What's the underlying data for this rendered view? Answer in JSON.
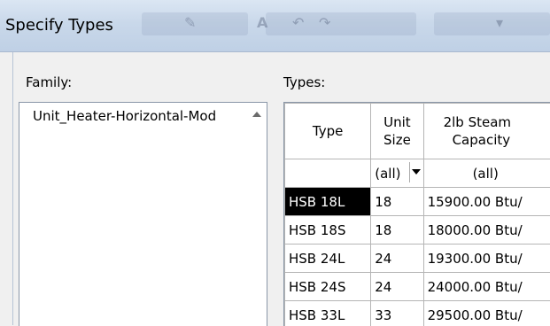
{
  "window": {
    "title": "Specify Types"
  },
  "family": {
    "label": "Family:",
    "items": [
      "Unit_Heater-Horizontal-Mod"
    ]
  },
  "types": {
    "label": "Types:",
    "columns": [
      {
        "line1": "Type",
        "line2": ""
      },
      {
        "line1": "Unit",
        "line2": "Size"
      },
      {
        "line1": "2lb Steam",
        "line2": "Capacity"
      }
    ],
    "filters": [
      "",
      "(all)",
      "(all)"
    ],
    "rows": [
      {
        "type": "HSB 18L",
        "unit_size": "18",
        "capacity": "15900.00 Btu/"
      },
      {
        "type": "HSB 18S",
        "unit_size": "18",
        "capacity": "18000.00 Btu/"
      },
      {
        "type": "HSB 24L",
        "unit_size": "24",
        "capacity": "19300.00 Btu/"
      },
      {
        "type": "HSB 24S",
        "unit_size": "24",
        "capacity": "24000.00 Btu/"
      },
      {
        "type": "HSB 33L",
        "unit_size": "33",
        "capacity": "29500.00 Btu/"
      }
    ],
    "selected_row": "HSB 18L"
  }
}
